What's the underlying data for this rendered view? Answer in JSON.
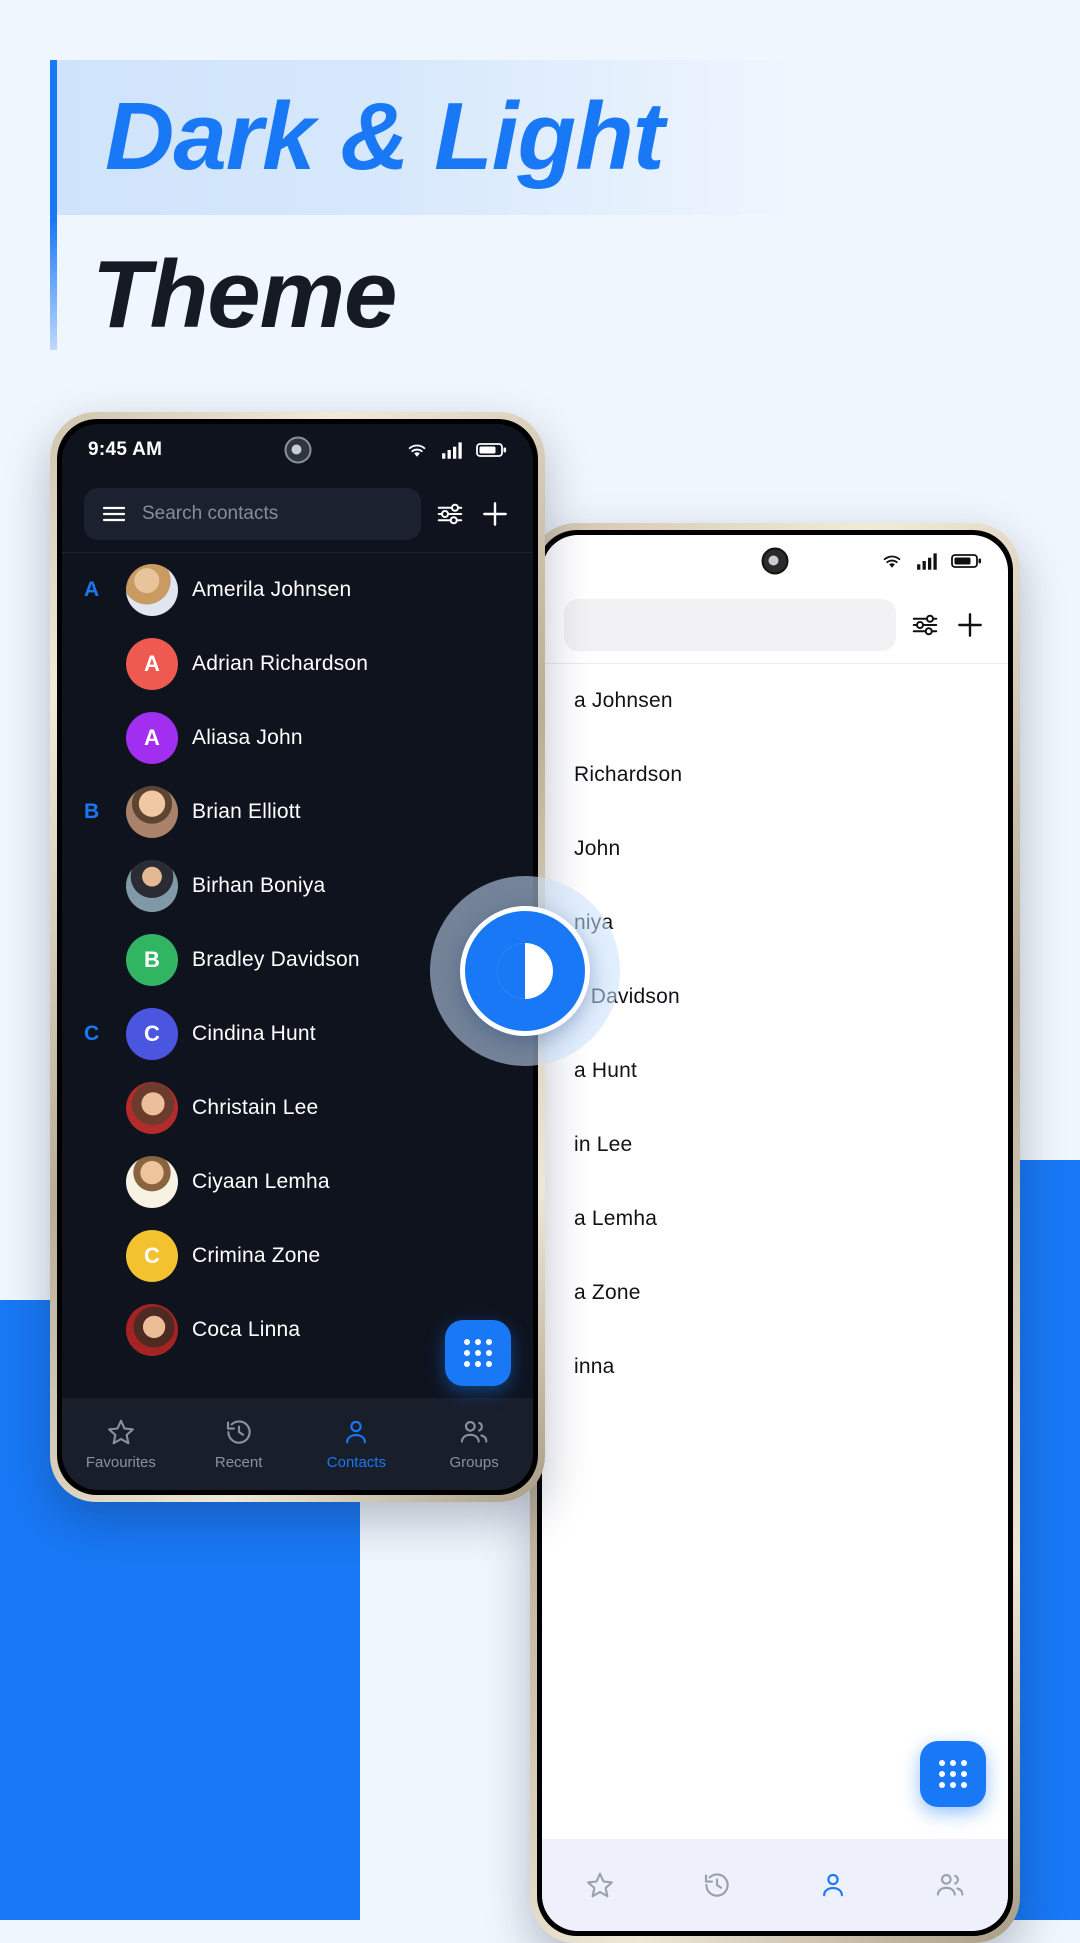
{
  "headline": {
    "line1": "Dark & Light",
    "line2": "Theme",
    "accent_color": "#1878f5",
    "dark_color": "#151a25"
  },
  "theme_toggle": {
    "name": "theme-toggle",
    "icon": "contrast-icon"
  },
  "dark_phone": {
    "theme": "dark",
    "status_bar": {
      "time": "9:45 AM",
      "icons": [
        "wifi-icon",
        "cellular-signal-icon",
        "battery-icon"
      ],
      "camera": "front-camera-punch-hole"
    },
    "search": {
      "placeholder": "Search contacts",
      "menu_icon": "hamburger-menu-icon",
      "filter_icon": "filter-sliders-icon",
      "add_icon": "plus-icon"
    },
    "contacts": [
      {
        "section": "A",
        "name": "Amerila Johnsen",
        "avatar_type": "photo",
        "photo": "woman-blonde",
        "color": "#d9c3a7"
      },
      {
        "section": "",
        "name": "Adrian Richardson",
        "avatar_type": "initial",
        "initial": "A",
        "color": "#ee5a4f"
      },
      {
        "section": "",
        "name": "Aliasa John",
        "avatar_type": "initial",
        "initial": "A",
        "color": "#a22ef0"
      },
      {
        "section": "B",
        "name": "Brian Elliott",
        "avatar_type": "photo",
        "photo": "man-beard",
        "color": "#f3c9a2"
      },
      {
        "section": "",
        "name": "Birhan Boniya",
        "avatar_type": "photo",
        "photo": "woman-dark-top",
        "color": "#7e95a1"
      },
      {
        "section": "",
        "name": "Bradley Davidson",
        "avatar_type": "initial",
        "initial": "B",
        "color": "#31b563"
      },
      {
        "section": "C",
        "name": "Cindina Hunt",
        "avatar_type": "initial",
        "initial": "C",
        "color": "#4a55e0"
      },
      {
        "section": "",
        "name": "Christain Lee",
        "avatar_type": "photo",
        "photo": "woman-red-flowers",
        "color": "#9d3a3a"
      },
      {
        "section": "",
        "name": "Ciyaan Lemha",
        "avatar_type": "photo",
        "photo": "woman-white-shirt",
        "color": "#f6e9b4"
      },
      {
        "section": "",
        "name": "Crimina Zone",
        "avatar_type": "initial",
        "initial": "C",
        "color": "#f2c230"
      },
      {
        "section": "",
        "name": "Coca Linna",
        "avatar_type": "photo",
        "photo": "woman-red-roses",
        "color": "#8d3030"
      }
    ],
    "fab": {
      "icon": "dialpad-icon",
      "color": "#1878f5"
    },
    "bottom_nav": [
      {
        "label": "Favourites",
        "icon": "star-icon",
        "active": false
      },
      {
        "label": "Recent",
        "icon": "history-icon",
        "active": false
      },
      {
        "label": "Contacts",
        "icon": "person-icon",
        "active": true
      },
      {
        "label": "Groups",
        "icon": "people-icon",
        "active": false
      }
    ]
  },
  "light_phone": {
    "theme": "light",
    "status_bar": {
      "icons": [
        "wifi-icon",
        "cellular-signal-icon",
        "battery-icon"
      ],
      "camera": "front-camera-punch-hole"
    },
    "search": {
      "placeholder": "",
      "filter_icon": "filter-sliders-icon",
      "add_icon": "plus-icon"
    },
    "contacts": [
      {
        "name": "a Johnsen"
      },
      {
        "name": "Richardson"
      },
      {
        "name": "John"
      },
      {
        "name": "niya"
      },
      {
        "name": "y Davidson"
      },
      {
        "name": "a Hunt"
      },
      {
        "name": "in Lee"
      },
      {
        "name": "a Lemha"
      },
      {
        "name": "a Zone"
      },
      {
        "name": "inna"
      }
    ],
    "fab": {
      "icon": "dialpad-icon",
      "color": "#1878f5"
    },
    "bottom_nav": [
      {
        "label": "",
        "icon": "star-icon",
        "active": false
      },
      {
        "label": "",
        "icon": "history-icon",
        "active": false
      },
      {
        "label": "",
        "icon": "person-icon",
        "active": true
      },
      {
        "label": "",
        "icon": "people-icon",
        "active": false
      }
    ]
  }
}
